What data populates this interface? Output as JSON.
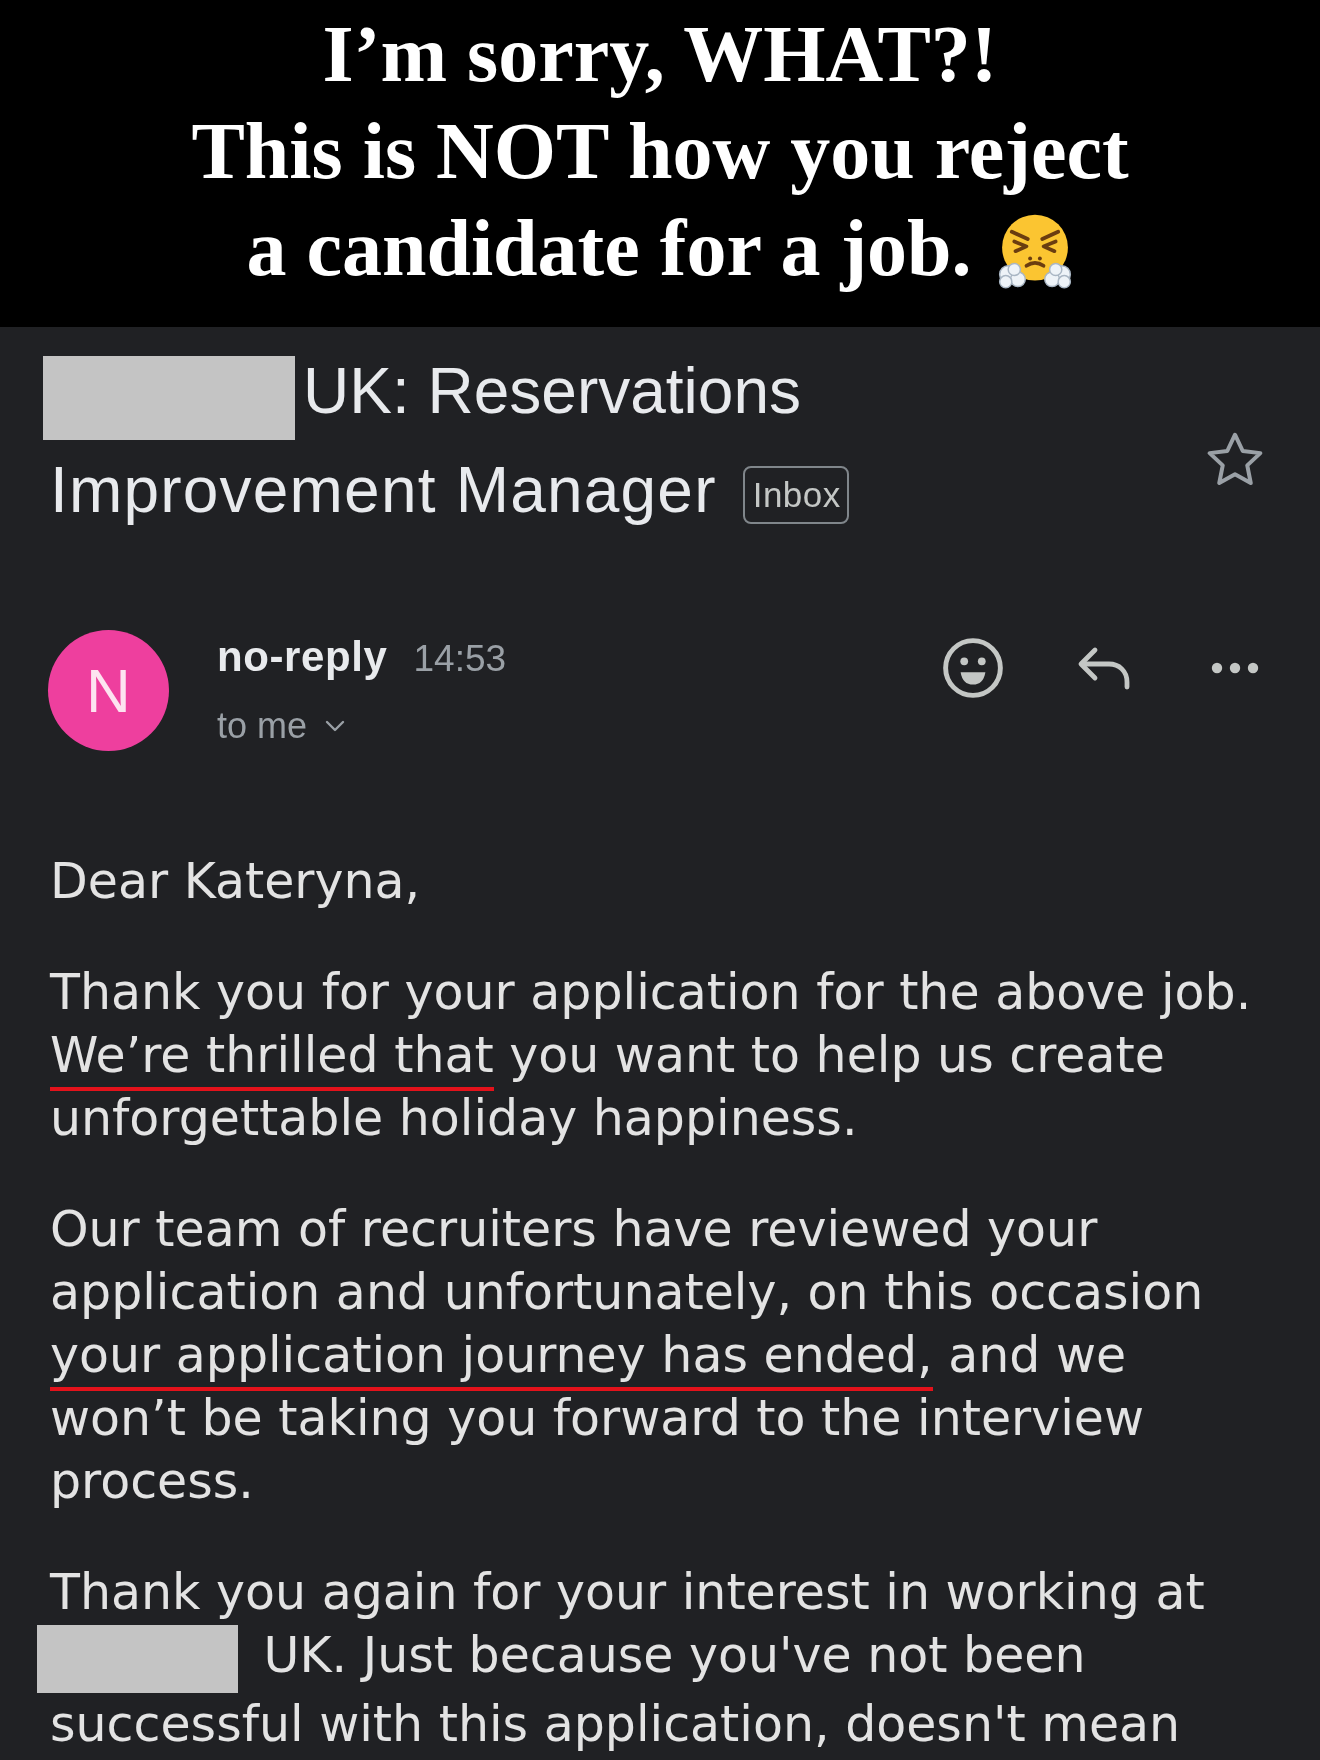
{
  "caption": {
    "lines": [
      "I’m sorry, WHAT?!",
      "This is NOT how you reject",
      "a candidate for a job."
    ]
  },
  "email": {
    "subject": [
      {
        "kind": "redaction"
      },
      {
        "kind": "text",
        "text": "UK: Reservations"
      },
      {
        "kind": "text",
        "text": "Improvement Manager"
      }
    ],
    "label": "Inbox",
    "starred": false,
    "sender": {
      "initial": "N",
      "name": "no-reply",
      "time": "14:53",
      "recipient": "to me"
    },
    "body": [
      {
        "runs": [
          {
            "kind": "text",
            "segments": [
              {
                "text": "Dear Kateryna,",
                "underlined": false
              }
            ]
          }
        ]
      },
      {
        "runs": [
          {
            "kind": "text",
            "segments": [
              {
                "text": "Thank you for your application for the above job. ",
                "underlined": false
              },
              {
                "text": "We’re thrilled that",
                "underlined": true
              },
              {
                "text": " you want to help us create unforgettable holiday happiness.",
                "underlined": false
              }
            ]
          }
        ]
      },
      {
        "runs": [
          {
            "kind": "text",
            "segments": [
              {
                "text": "Our team of recruiters have reviewed your application and unfortunately, on this occasion ",
                "underlined": false
              },
              {
                "text": "your application journey has ended,",
                "underlined": true
              },
              {
                "text": " and we won’t be taking you forward to the interview process.",
                "underlined": false
              }
            ]
          }
        ]
      },
      {
        "runs": [
          {
            "kind": "text",
            "segments": [
              {
                "text": "Thank you again for your interest in working at",
                "underlined": false
              }
            ]
          },
          {
            "kind": "redaction"
          },
          {
            "kind": "text",
            "segments": [
              {
                "text": "UK. Just because you've not been",
                "underlined": false
              }
            ]
          },
          {
            "kind": "text",
            "segments": [
              {
                "text": "successful with this application, doesn't mean",
                "underlined": false
              }
            ]
          }
        ]
      }
    ]
  }
}
